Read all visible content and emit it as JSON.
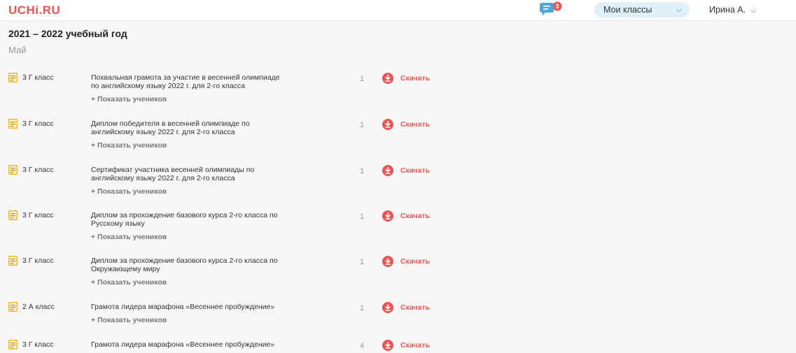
{
  "header": {
    "logo": "UCHi.RU",
    "notifications_count": "3",
    "classes_label": "Мои классы",
    "user_name": "Ирина А."
  },
  "school_year": "2021 – 2022 учебный год",
  "month": "Май",
  "show_students_label": "+ Показать учеников",
  "download_label": "Скачать",
  "colors": {
    "accent": "#e85555",
    "notify_blue": "#4aa8dc",
    "pill_bg": "#dff0f9",
    "doc_icon": "#f0b429"
  },
  "rows": [
    {
      "class": "3 Г класс",
      "title_lines": [
        "Похвальная грамота за участие в весенней олимпиаде",
        "по английскому языку 2022 г. для 2-го класса"
      ],
      "count": "1",
      "show_students": true
    },
    {
      "class": "3 Г класс",
      "title_lines": [
        "Диплом победителя в весенней олимпиаде по",
        "английскому языку 2022 г. для 2-го класса"
      ],
      "count": "1",
      "show_students": true
    },
    {
      "class": "3 Г класс",
      "title_lines": [
        "Сертификат участника весенней олимпиады по",
        "английскому языку 2022 г. для 2-го класса"
      ],
      "count": "1",
      "show_students": true
    },
    {
      "class": "3 Г класс",
      "title_lines": [
        "Диплом за прохождение базового курса 2-го класса по",
        "Русскому языку"
      ],
      "count": "1",
      "show_students": true
    },
    {
      "class": "3 Г класс",
      "title_lines": [
        "Диплом за прохождение базового курса 2-го класса по",
        "Окружающему миру"
      ],
      "count": "1",
      "show_students": true
    },
    {
      "class": "2 А класс",
      "title_lines": [
        "Грамота лидера марафона «Весеннее пробуждение»"
      ],
      "count": "1",
      "show_students": true
    },
    {
      "class": "3 Г класс",
      "title_lines": [
        "Грамота лидера марафона «Весеннее пробуждение»"
      ],
      "count": "4",
      "show_students": false
    }
  ]
}
